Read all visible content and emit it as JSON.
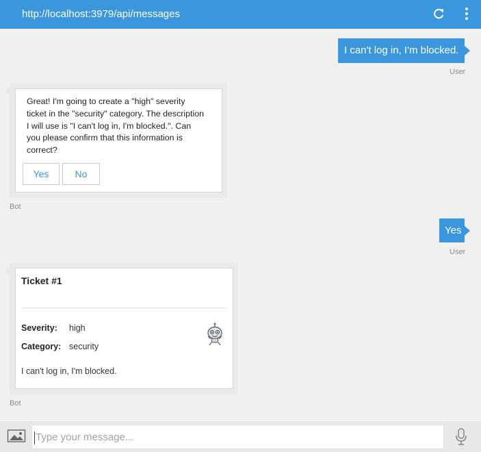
{
  "header": {
    "url": "http://localhost:3979/api/messages",
    "refresh_icon": "refresh-icon",
    "menu_icon": "more-vertical-icon",
    "background": "#3a96dd"
  },
  "messages": [
    {
      "from": "User",
      "text": "I can't log in, I'm blocked."
    },
    {
      "from": "Bot",
      "text": "Great! I'm going to create a \"high\" severity ticket in the \"security\" category. The description I will use is \"I can't log in, I'm blocked.\". Can you please confirm that this information is correct?",
      "buttons": [
        "Yes",
        "No"
      ]
    },
    {
      "from": "User",
      "text": "Yes"
    },
    {
      "from": "Bot",
      "card": {
        "title": "Ticket #1",
        "facts": [
          {
            "label": "Severity:",
            "value": "high"
          },
          {
            "label": "Category:",
            "value": "security"
          }
        ],
        "description": "I can't log in, I'm blocked.",
        "image_icon": "robot-icon"
      }
    }
  ],
  "composer": {
    "placeholder": "Type your message...",
    "upload_icon": "image-upload-icon",
    "mic_icon": "microphone-icon"
  },
  "colors": {
    "accent": "#3a96dd",
    "chat_background": "#f0f0f0",
    "bot_frame": "#e7e9ea"
  }
}
